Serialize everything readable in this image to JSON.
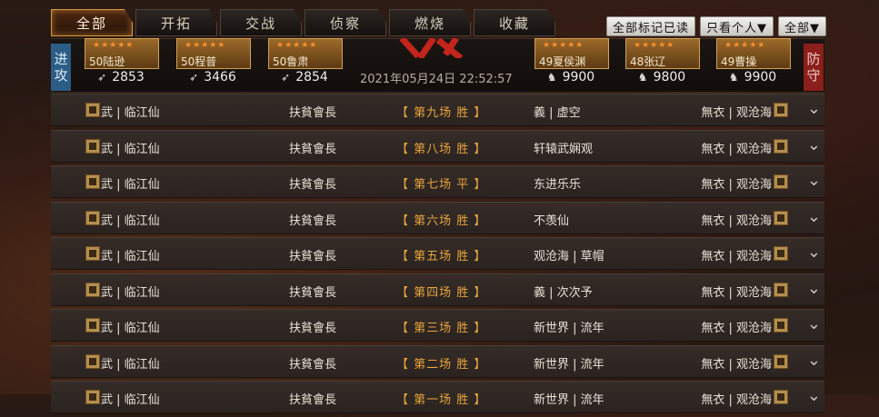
{
  "tabs": [
    "全部",
    "开拓",
    "交战",
    "侦察",
    "燃烧",
    "收藏"
  ],
  "filters": {
    "mark_read": "全部标记已读",
    "personal": "只看个人▼",
    "all": "全部▼"
  },
  "side": {
    "attack": [
      "进",
      "攻"
    ],
    "defend": [
      "防",
      "守"
    ]
  },
  "attackers": [
    {
      "level_name": "50陆逊",
      "power": "2853",
      "stars": "★★★★★"
    },
    {
      "level_name": "50程普",
      "power": "3466",
      "stars": "★★★★★"
    },
    {
      "level_name": "50鲁肃",
      "power": "2854",
      "stars": "★★★★★"
    }
  ],
  "defenders": [
    {
      "level_name": "49夏侯渊",
      "power": "9900",
      "stars": "★★★★★"
    },
    {
      "level_name": "48张辽",
      "power": "9800",
      "stars": "★★★★★"
    },
    {
      "level_name": "49曹操",
      "power": "9900",
      "stars": "★★★★★"
    }
  ],
  "battle_time": "2021年05月24日 22:52:57",
  "rows": [
    {
      "atk": "武 | 临江仙",
      "atk_alliance": "扶貧會長",
      "result": "【 第九场 胜 】",
      "def": "義 | 虚空",
      "def_right": "無衣 | 观沧海"
    },
    {
      "atk": "武 | 临江仙",
      "atk_alliance": "扶貧會長",
      "result": "【 第八场 胜 】",
      "def": "轩辕武娴观",
      "def_right": "無衣 | 观沧海"
    },
    {
      "atk": "武 | 临江仙",
      "atk_alliance": "扶貧會長",
      "result": "【 第七场 平 】",
      "def": "东进乐乐",
      "def_right": "無衣 | 观沧海"
    },
    {
      "atk": "武 | 临江仙",
      "atk_alliance": "扶貧會長",
      "result": "【 第六场 胜 】",
      "def": "不羡仙",
      "def_right": "無衣 | 观沧海"
    },
    {
      "atk": "武 | 临江仙",
      "atk_alliance": "扶貧會長",
      "result": "【 第五场 胜 】",
      "def": "观沧海 | 草帽",
      "def_right": "無衣 | 观沧海"
    },
    {
      "atk": "武 | 临江仙",
      "atk_alliance": "扶貧會長",
      "result": "【 第四场 胜 】",
      "def": "義 | 次次予",
      "def_right": "無衣 | 观沧海"
    },
    {
      "atk": "武 | 临江仙",
      "atk_alliance": "扶貧會長",
      "result": "【 第三场 胜 】",
      "def": "新世界 | 流年",
      "def_right": "無衣 | 观沧海"
    },
    {
      "atk": "武 | 临江仙",
      "atk_alliance": "扶貧會長",
      "result": "【 第二场 胜 】",
      "def": "新世界 | 流年",
      "def_right": "無衣 | 观沧海"
    },
    {
      "atk": "武 | 临江仙",
      "atk_alliance": "扶貧會長",
      "result": "【 第一场 胜 】",
      "def": "新世界 | 流年",
      "def_right": "無衣 | 观沧海"
    }
  ]
}
